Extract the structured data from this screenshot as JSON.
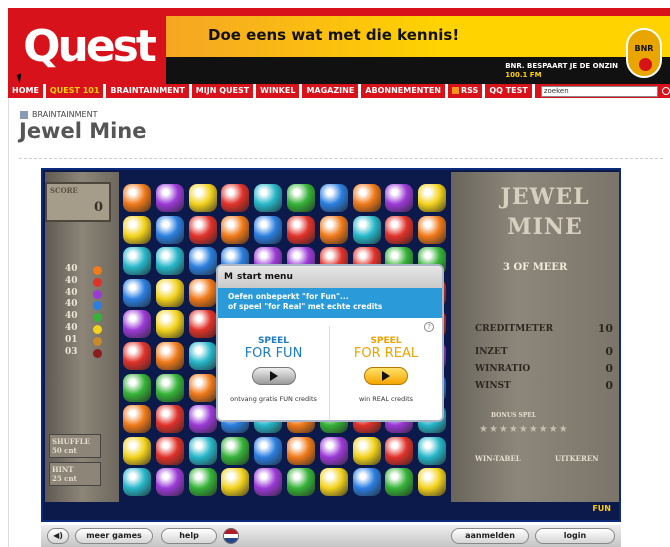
{
  "header": {
    "logo": "Quest",
    "banner_title": "Doe eens wat met die kennis!",
    "bnr_line1": "BNR. BESPAART JE DE ONZIN",
    "bnr_line2": "100.1 FM",
    "bnr_logo": "BNR"
  },
  "nav": {
    "items": [
      "HOME",
      "QUEST 101",
      "BRAINTAINMENT",
      "MIJN QUEST",
      "WINKEL",
      "MAGAZINE",
      "ABONNEMENTEN",
      "RSS",
      "QQ TEST"
    ],
    "active": "QUEST 101",
    "search_placeholder": "zoeken"
  },
  "page": {
    "breadcrumb": "BRAINTAINMENT",
    "title": "Jewel Mine"
  },
  "game": {
    "score_label": "SCORE",
    "score_value": "0",
    "points": [
      "40",
      "40",
      "40",
      "40",
      "40",
      "40",
      "01",
      "03"
    ],
    "shuffle_label": "SHUFFLE",
    "shuffle_cost": "50 cnt",
    "hint_label": "HINT",
    "hint_cost": "25 cnt",
    "logo_line1": "JEWEL",
    "logo_line2": "MINE",
    "min_match": "3 OF MEER",
    "creditmeter_label": "CREDITMETER",
    "creditmeter_value": "10",
    "inzet_label": "INZET",
    "inzet_value": "0",
    "winratio_label": "WINRATIO",
    "winratio_value": "0",
    "winst_label": "WINST",
    "winst_value": "0",
    "bonus_label": "BONUS SPEL",
    "wintabel_label": "WIN-TABEL",
    "uitkeren_label": "UITKEREN",
    "fun_badge": "FUN",
    "colors": {
      "red": "#e0322a",
      "orange": "#f07a1a",
      "yellow": "#f2d21c",
      "green": "#36b338",
      "blue": "#2b7fe0",
      "purple": "#9b3ad6",
      "teal": "#27b7c9"
    }
  },
  "modal": {
    "title": "start menu",
    "sub_line1": "Oefen onbeperkt \"for Fun\"...",
    "sub_line2": "of speel \"for Real\" met echte credits",
    "fun_top": "SPEEL",
    "fun_bottom": "FOR FUN",
    "fun_caption": "ontvang gratis FUN credits",
    "real_top": "SPEEL",
    "real_bottom": "FOR REAL",
    "real_caption": "win REAL credits"
  },
  "bottombar": {
    "meer_games": "meer games",
    "help": "help",
    "aanmelden": "aanmelden",
    "login": "login"
  }
}
